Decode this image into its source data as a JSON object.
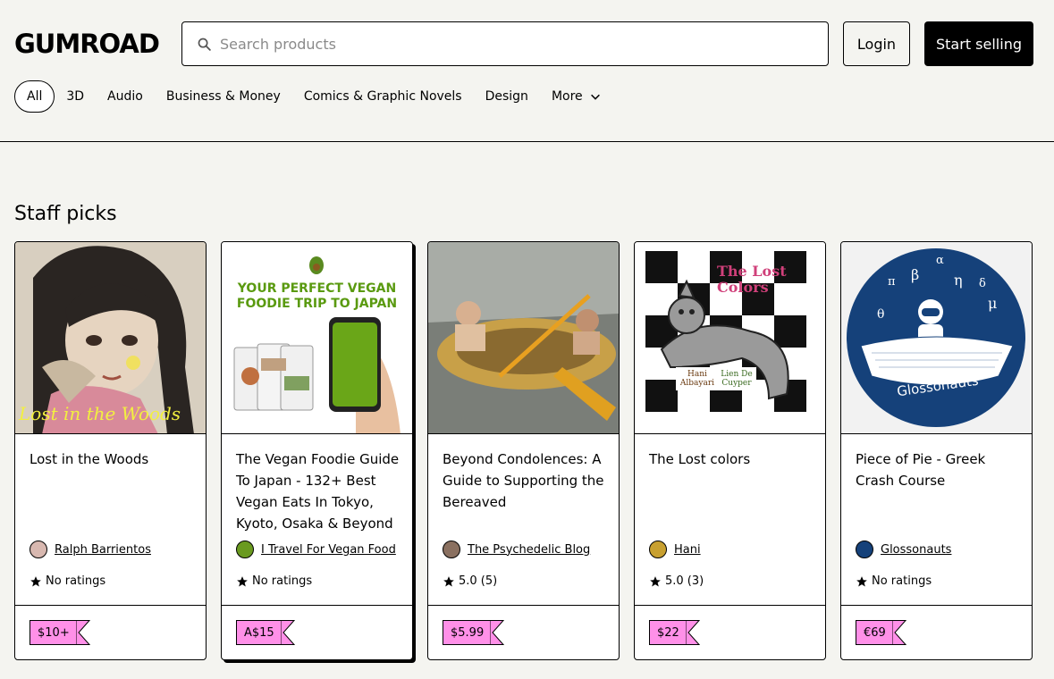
{
  "header": {
    "logo": "GUMROAD",
    "search_placeholder": "Search products",
    "login_label": "Login",
    "sell_label": "Start selling"
  },
  "nav": {
    "items": [
      "All",
      "3D",
      "Audio",
      "Business & Money",
      "Comics & Graphic Novels",
      "Design",
      "More"
    ]
  },
  "section_title": "Staff picks",
  "products": [
    {
      "title": "Lost in the Woods",
      "cover_text": "Lost in the Woods",
      "creator": "Ralph Barrientos",
      "rating": "No ratings",
      "price": "$10+"
    },
    {
      "title": "The Vegan Foodie Guide To Japan - 132+ Best Vegan Eats In Tokyo, Kyoto, Osaka & Beyond",
      "cover_text": "YOUR PERFECT VEGAN FOODIE TRIP TO JAPAN",
      "creator": "I Travel For Vegan Food",
      "rating": "No ratings",
      "price": "A$15"
    },
    {
      "title": "Beyond Condolences: A Guide to Supporting the Bereaved",
      "creator": "The Psychedelic Blog",
      "rating": "5.0 (5)",
      "price": "$5.99"
    },
    {
      "title": "The Lost colors",
      "cover_text": "The Lost Colors",
      "cover_authors": [
        "Hani Albayari",
        "Lien De Cuyper"
      ],
      "creator": "Hani",
      "rating": "5.0 (3)",
      "price": "$22"
    },
    {
      "title": "Piece of Pie - Greek Crash Course",
      "cover_text": "Glossonauts",
      "creator": "Glossonauts",
      "rating": "No ratings",
      "price": "€69"
    }
  ],
  "colors": {
    "background": "#f4f4f0",
    "price_tag": "#ff90e8",
    "primary_button": "#000000"
  }
}
